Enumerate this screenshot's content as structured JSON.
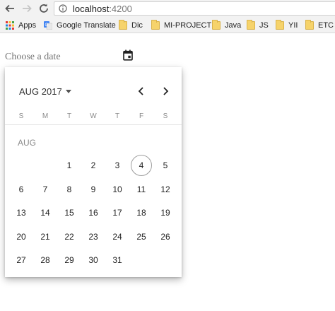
{
  "browser": {
    "url_host": "localhost",
    "url_port": ":4200",
    "bookmarks": [
      {
        "label": "Apps",
        "icon": "apps-grid-icon"
      },
      {
        "label": "Google Translate",
        "icon": "google-translate-icon"
      },
      {
        "label": "Dic",
        "icon": "folder-icon"
      },
      {
        "label": "MI-PROJECT",
        "icon": "folder-icon"
      },
      {
        "label": "Java",
        "icon": "folder-icon"
      },
      {
        "label": "JS",
        "icon": "folder-icon"
      },
      {
        "label": "YII",
        "icon": "folder-icon"
      },
      {
        "label": "ETC",
        "icon": "folder-icon"
      }
    ]
  },
  "page": {
    "date_placeholder": "Choose a date"
  },
  "calendar": {
    "period_label": "AUG 2017",
    "weekdays": [
      "S",
      "M",
      "T",
      "W",
      "T",
      "F",
      "S"
    ],
    "month_label": "AUG",
    "first_day_column": 2,
    "days": [
      "1",
      "2",
      "3",
      "4",
      "5",
      "6",
      "7",
      "8",
      "9",
      "10",
      "11",
      "12",
      "13",
      "14",
      "15",
      "16",
      "17",
      "18",
      "19",
      "20",
      "21",
      "22",
      "23",
      "24",
      "25",
      "26",
      "27",
      "28",
      "29",
      "30",
      "31"
    ],
    "today": "4",
    "colors": {
      "today_ring": "#9e9e9e"
    }
  }
}
